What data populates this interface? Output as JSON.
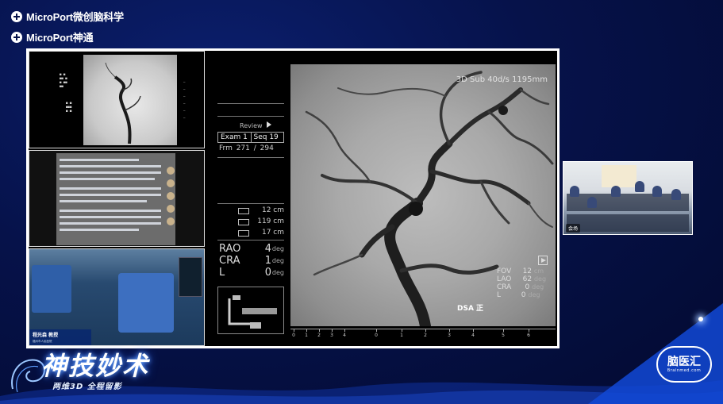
{
  "header": {
    "logo1": "MicroPort微创脑科学",
    "logo2": "MicroPort神通"
  },
  "thumbs": {
    "surgeon_name": "程光森 教授",
    "surgeon_org": "福州市人民医院"
  },
  "viewer": {
    "review_label": "Review",
    "exam": "Exam  1",
    "seq": "Seq  19",
    "frm": "Frm   271  /  294",
    "dist1": "12 cm",
    "dist2": "119 cm",
    "dist3": "17 cm",
    "rao_label": "RAO",
    "rao_val": "4",
    "cra_label": "CRA",
    "cra_val": "1",
    "l_label": "L",
    "l_val": "0",
    "deg": "deg",
    "subtitle": "3D Sub  40d/s  1195mm",
    "dsa": "DSA 正",
    "fov_label": "FOV",
    "fov_val": "12",
    "fov_unit": "cm",
    "lao_label": "LAO",
    "lao_val": "62",
    "cra2_label": "CRA",
    "cra2_val": "0",
    "l2_label": "L",
    "l2_val": "0",
    "scale_labels": [
      "0",
      "1",
      "2",
      "3",
      "4",
      "0",
      "1",
      "2",
      "3",
      "4",
      "5",
      "6"
    ]
  },
  "camera": {
    "tag": "会场"
  },
  "branding": {
    "title": "神技妙术",
    "subtitle": "两维3D 全程留影",
    "logo_main": "脑医汇",
    "logo_sub": "Brainmed.com"
  },
  "colors": {
    "background": "#06124a",
    "accent": "#1249d6",
    "frame": "#ffffff"
  }
}
